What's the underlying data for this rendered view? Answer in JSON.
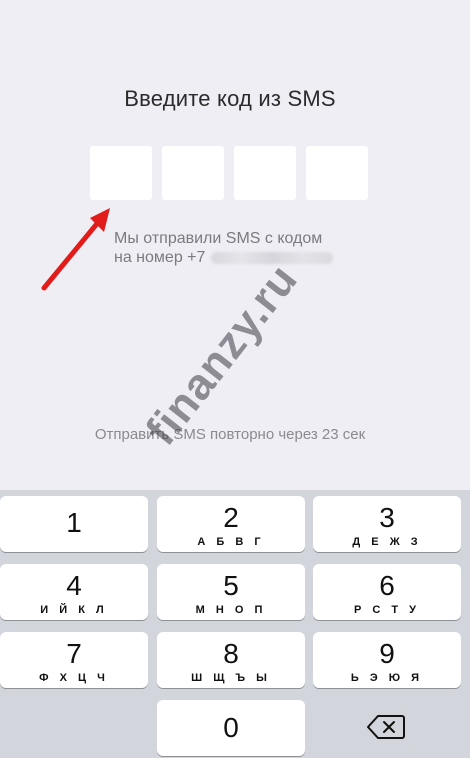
{
  "screen": {
    "title": "Введите код из SMS",
    "code_boxes": [
      "",
      "",
      "",
      ""
    ],
    "sent_line1": "Мы отправили SMS с кодом",
    "sent_line2": "на номер +7",
    "resend_text": "Отправить SMS повторно через 23 сек",
    "watermark": "finanzy.ru",
    "arrow_color": "#e21b1b"
  },
  "keyboard": {
    "keys": [
      {
        "num": "1",
        "letters": ""
      },
      {
        "num": "2",
        "letters": "А Б В Г"
      },
      {
        "num": "3",
        "letters": "Д Е Ж З"
      },
      {
        "num": "4",
        "letters": "И Й К Л"
      },
      {
        "num": "5",
        "letters": "М Н О П"
      },
      {
        "num": "6",
        "letters": "Р С Т У"
      },
      {
        "num": "7",
        "letters": "Ф Х Ц Ч"
      },
      {
        "num": "8",
        "letters": "Ш Щ Ъ Ы"
      },
      {
        "num": "9",
        "letters": "Ь Э Ю Я"
      },
      {
        "num": "0",
        "letters": ""
      }
    ],
    "delete_icon": "backspace-icon"
  }
}
